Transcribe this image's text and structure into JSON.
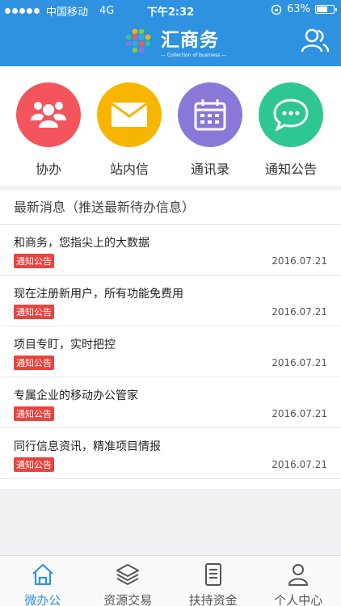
{
  "status_bar": {
    "carrier": "中国移动",
    "network": "4G",
    "time": "下午2:32",
    "battery": "63%",
    "battery_level": 0.63
  },
  "header": {
    "app_name": "汇商务",
    "tagline": "— Collection of business —"
  },
  "apps": [
    {
      "label": "协办",
      "color": "#f4545c",
      "icon": "people-icon"
    },
    {
      "label": "站内信",
      "color": "#f7b500",
      "icon": "mail-icon"
    },
    {
      "label": "通讯录",
      "color": "#8a78d8",
      "icon": "calendar-icon"
    },
    {
      "label": "通知公告",
      "color": "#2ec793",
      "icon": "chat-icon"
    }
  ],
  "news": {
    "section_title": "最新消息（推送最新待办信息）",
    "items": [
      {
        "title": "和商务，您指尖上的大数据",
        "tag": "通知公告",
        "date": "2016.07.21"
      },
      {
        "title": "现在注册新用户，所有功能免费用",
        "tag": "通知公告",
        "date": "2016.07.21"
      },
      {
        "title": "项目专盯，实时把控",
        "tag": "通知公告",
        "date": "2016.07.21"
      },
      {
        "title": "专属企业的移动办公管家",
        "tag": "通知公告",
        "date": "2016.07.21"
      },
      {
        "title": "同行信息资讯，精准项目情报",
        "tag": "通知公告",
        "date": "2016.07.21"
      }
    ]
  },
  "tabs": [
    {
      "label": "微办公",
      "icon": "home-icon",
      "active": true
    },
    {
      "label": "资源交易",
      "icon": "layers-icon",
      "active": false
    },
    {
      "label": "扶持资金",
      "icon": "document-icon",
      "active": false
    },
    {
      "label": "个人中心",
      "icon": "person-icon",
      "active": false
    }
  ],
  "colors": {
    "primary": "#2e92e1",
    "tag_red": "#e8443e",
    "background": "#f1f1f3"
  }
}
